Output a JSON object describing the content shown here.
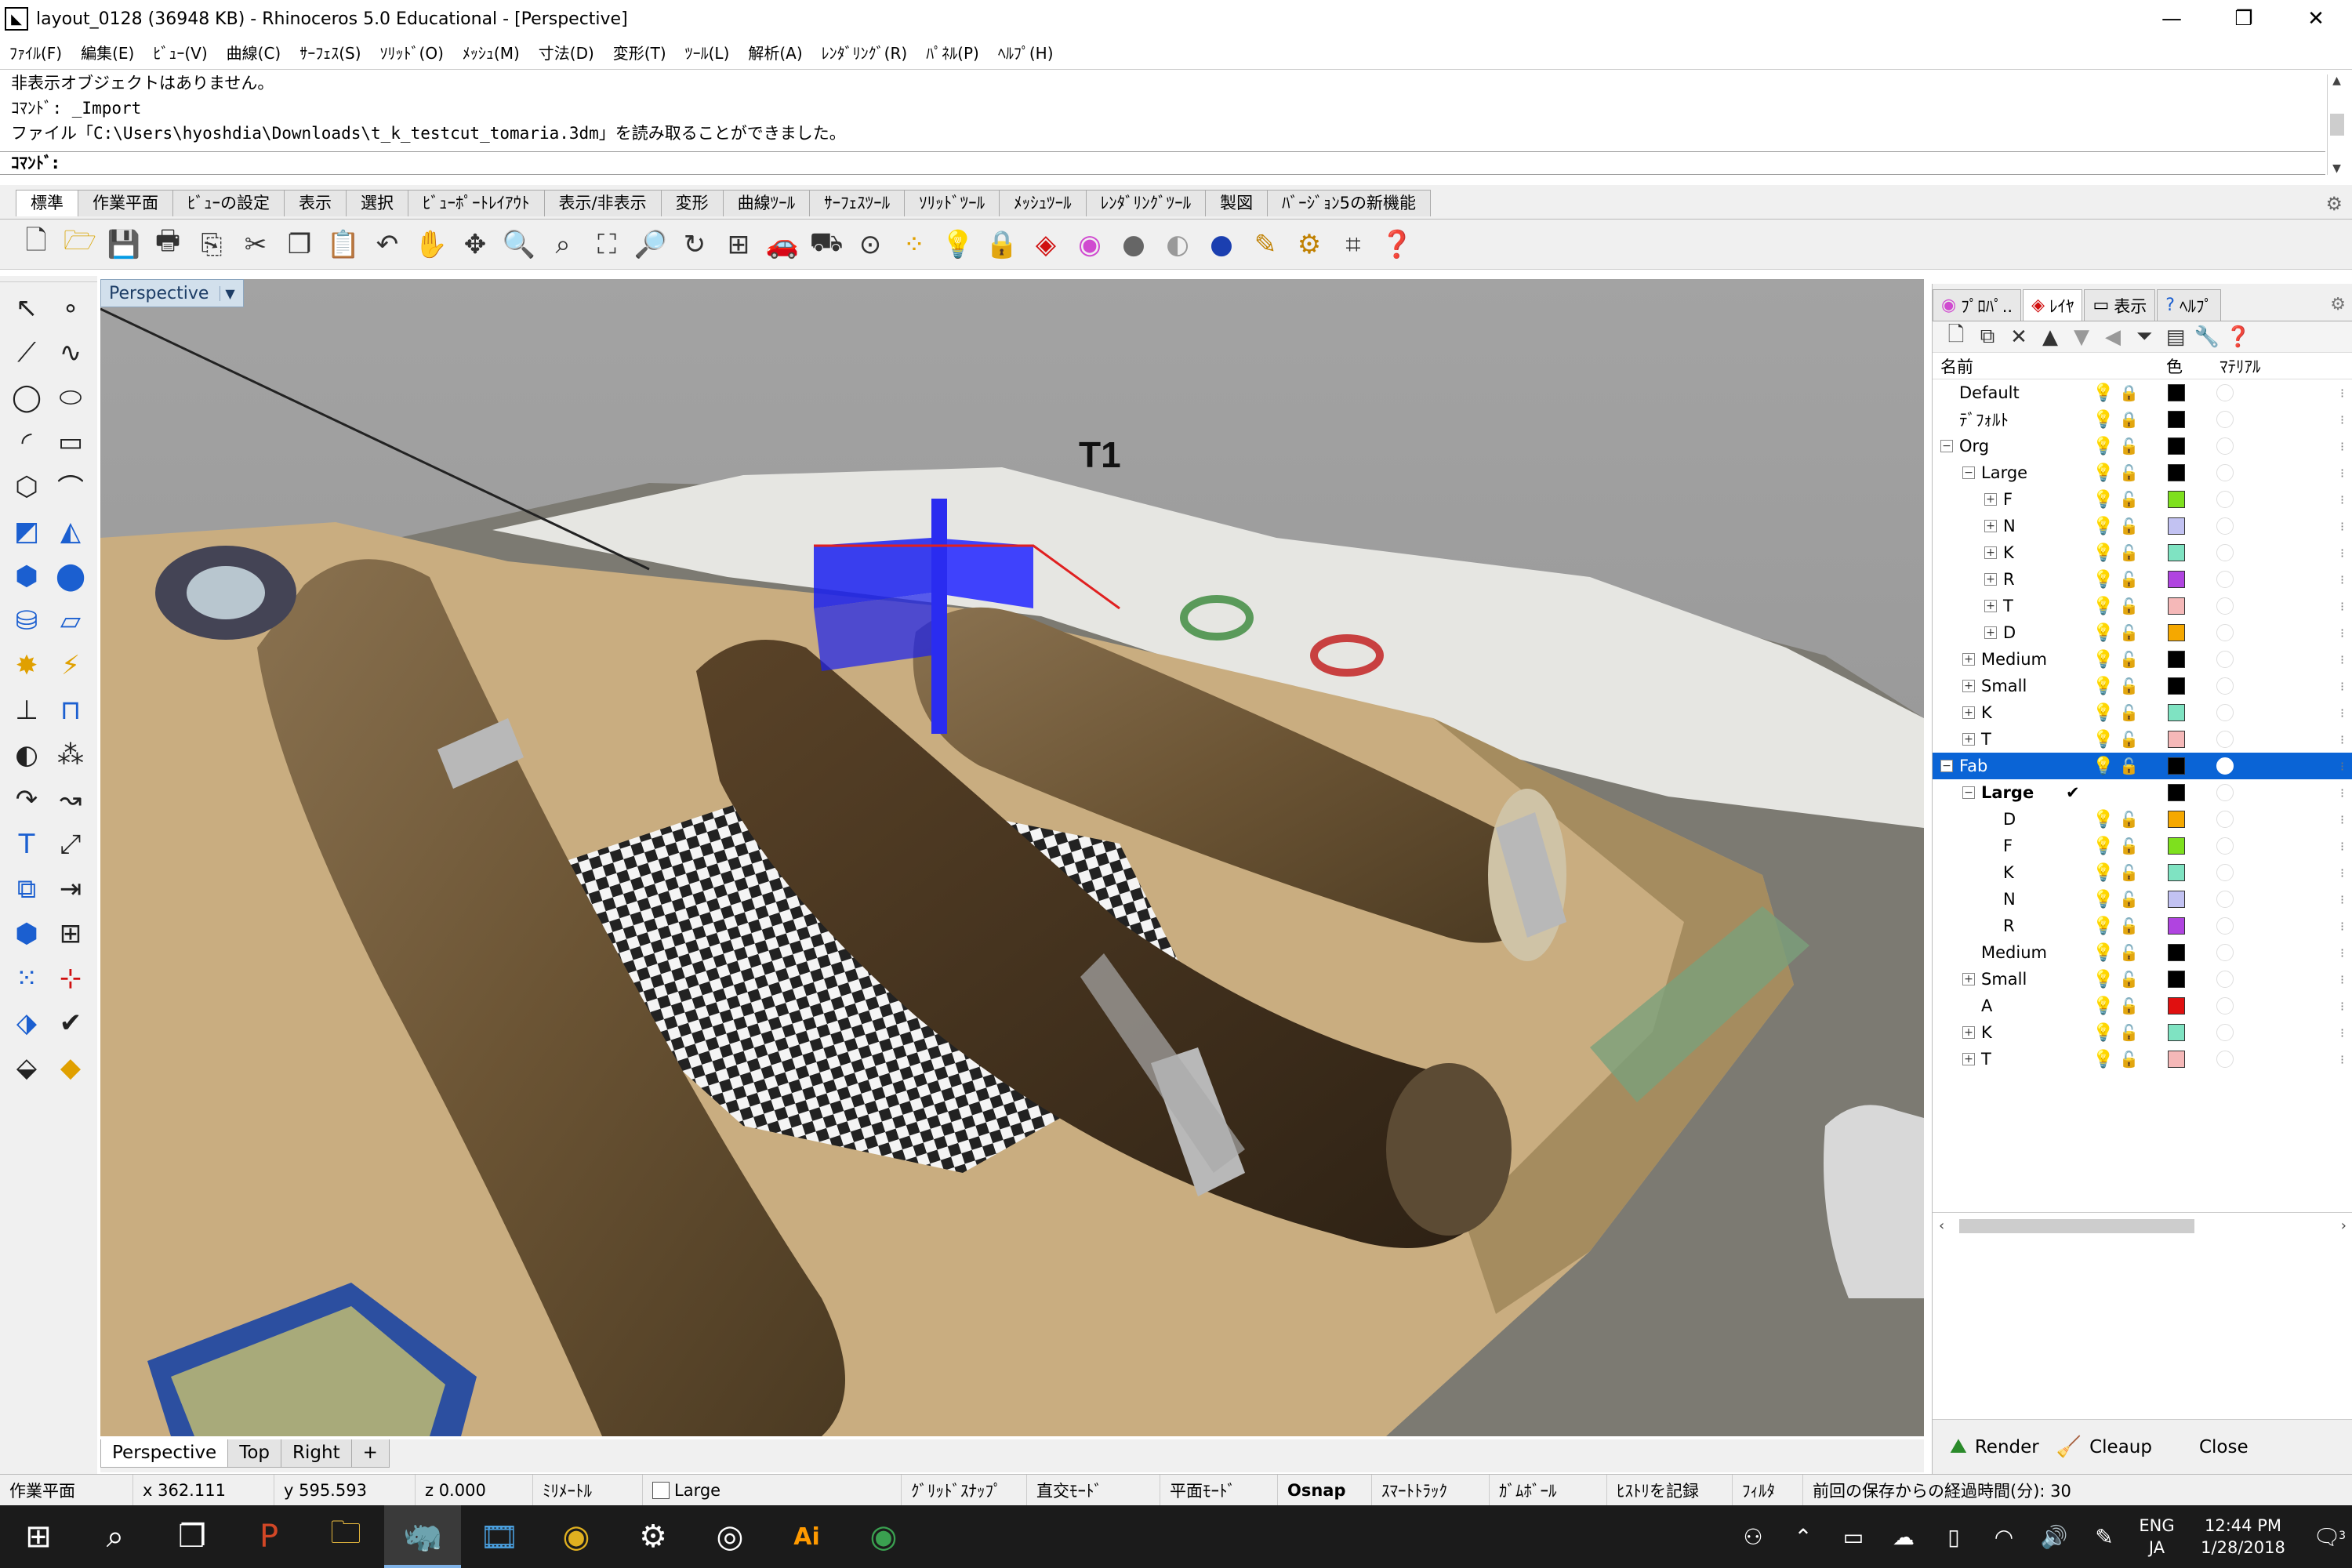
{
  "window": {
    "title": "layout_0128 (36948 KB) - Rhinoceros 5.0 Educational - [Perspective]",
    "app_icon": "rhino-icon",
    "minimize": "—",
    "maximize": "❐",
    "close": "✕"
  },
  "menu": [
    "ﾌｧｲﾙ(F)",
    "編集(E)",
    "ﾋﾞｭｰ(V)",
    "曲線(C)",
    "ｻｰﾌｪｽ(S)",
    "ｿﾘｯﾄﾞ(O)",
    "ﾒｯｼｭ(M)",
    "寸法(D)",
    "変形(T)",
    "ﾂｰﾙ(L)",
    "解析(A)",
    "ﾚﾝﾀﾞﾘﾝｸﾞ(R)",
    "ﾊﾟﾈﾙ(P)",
    "ﾍﾙﾌﾟ(H)"
  ],
  "command": {
    "history": [
      "非表示オブジェクトはありません。",
      "ｺﾏﾝﾄﾞ: _Import",
      "ファイル「C:\\Users\\hyoshdia\\Downloads\\t_k_testcut_tomaria.3dm」を読み取ることができました。"
    ],
    "prompt": "ｺﾏﾝﾄﾞ:"
  },
  "toolbar_tabs": [
    "標準",
    "作業平面",
    "ﾋﾞｭｰの設定",
    "表示",
    "選択",
    "ﾋﾞｭｰﾎﾟｰﾄﾚｲｱｳﾄ",
    "表示/非表示",
    "変形",
    "曲線ﾂｰﾙ",
    "ｻｰﾌｪｽﾂｰﾙ",
    "ｿﾘｯﾄﾞﾂｰﾙ",
    "ﾒｯｼｭﾂｰﾙ",
    "ﾚﾝﾀﾞﾘﾝｸﾞﾂｰﾙ",
    "製図",
    "ﾊﾞｰｼﾞｮﾝ5の新機能"
  ],
  "toolbar_icons": [
    "new-file-icon",
    "open-folder-icon",
    "save-icon",
    "print-icon",
    "import-icon",
    "cut-icon",
    "copy-icon",
    "paste-icon",
    "undo-icon",
    "pan-hand-icon",
    "rotate-view-icon",
    "zoom-icon",
    "zoom-window-icon",
    "zoom-extents-icon",
    "zoom-selected-icon",
    "rotate-camera-icon",
    "four-viewports-icon",
    "car-icon",
    "render-preview-icon",
    "cplane-icon",
    "points-icon",
    "lightbulb-icon",
    "lock-icon",
    "layer-icon",
    "color-wheel-icon",
    "sphere-shaded-icon",
    "sphere-rendered-icon",
    "sphere-blue-icon",
    "pen-icon",
    "gear-icon",
    "dimension-icon",
    "help-icon"
  ],
  "viewport": {
    "name": "Perspective",
    "annotation": "T1",
    "tabs": [
      "Perspective",
      "Top",
      "Right"
    ],
    "add_tab": "+"
  },
  "right_panel": {
    "tabs": [
      {
        "label": "ﾌﾟﾛﾊﾟ..",
        "icon": "properties-icon"
      },
      {
        "label": "ﾚｲﾔ",
        "icon": "layers-icon"
      },
      {
        "label": "表示",
        "icon": "display-icon"
      },
      {
        "label": "ﾍﾙﾌﾟ",
        "icon": "help-tab-icon"
      }
    ],
    "columns": {
      "name": "名前",
      "color": "色",
      "material": "ﾏﾃﾘｱﾙ"
    },
    "layers": [
      {
        "name": "Default",
        "level": 0,
        "expander": "",
        "bulb": "#f2d100",
        "lock": "locked",
        "color": "#000000"
      },
      {
        "name": "ﾃﾞﾌｫﾙﾄ",
        "level": 0,
        "expander": "",
        "bulb": "#f2d100",
        "lock": "locked",
        "color": "#000000"
      },
      {
        "name": "Org",
        "level": 0,
        "expander": "−",
        "bulb": "#f2d100",
        "lock": "open",
        "color": "#000000"
      },
      {
        "name": "Large",
        "level": 1,
        "expander": "−",
        "bulb": "#f2d100",
        "lock": "open",
        "color": "#000000"
      },
      {
        "name": "F",
        "level": 2,
        "expander": "+",
        "bulb": "#2a8bd6",
        "lock": "open",
        "color": "#7ee01e"
      },
      {
        "name": "N",
        "level": 2,
        "expander": "+",
        "bulb": "#2a8bd6",
        "lock": "open",
        "color": "#c2c2f2"
      },
      {
        "name": "K",
        "level": 2,
        "expander": "+",
        "bulb": "#2a8bd6",
        "lock": "open",
        "color": "#7fe3c2"
      },
      {
        "name": "R",
        "level": 2,
        "expander": "+",
        "bulb": "#2a8bd6",
        "lock": "open",
        "color": "#b044e0"
      },
      {
        "name": "T",
        "level": 2,
        "expander": "+",
        "bulb": "#2a8bd6",
        "lock": "open",
        "color": "#f5b8b8"
      },
      {
        "name": "D",
        "level": 2,
        "expander": "+",
        "bulb": "#2a8bd6",
        "lock": "open",
        "color": "#f5a800"
      },
      {
        "name": "Medium",
        "level": 1,
        "expander": "+",
        "bulb": "#2a8bd6",
        "lock": "open",
        "color": "#000000"
      },
      {
        "name": "Small",
        "level": 1,
        "expander": "+",
        "bulb": "#2a8bd6",
        "lock": "open",
        "color": "#000000"
      },
      {
        "name": "K",
        "level": 1,
        "expander": "+",
        "bulb": "#2a8bd6",
        "lock": "open",
        "color": "#7fe3c2"
      },
      {
        "name": "T",
        "level": 1,
        "expander": "+",
        "bulb": "#2a8bd6",
        "lock": "open",
        "color": "#f5b8b8"
      },
      {
        "name": "Fab",
        "level": 0,
        "expander": "−",
        "bulb": "#f2d100",
        "lock": "open",
        "color": "#000000",
        "selected": true
      },
      {
        "name": "Large",
        "level": 1,
        "expander": "−",
        "bulb": "",
        "lock": "",
        "color": "#000000",
        "current": true,
        "check": "✔"
      },
      {
        "name": "D",
        "level": 2,
        "expander": "",
        "bulb": "#2a8bd6",
        "lock": "open",
        "color": "#f5a800"
      },
      {
        "name": "F",
        "level": 2,
        "expander": "",
        "bulb": "#2a8bd6",
        "lock": "open",
        "color": "#7ee01e"
      },
      {
        "name": "K",
        "level": 2,
        "expander": "",
        "bulb": "#2a8bd6",
        "lock": "open",
        "color": "#7fe3c2"
      },
      {
        "name": "N",
        "level": 2,
        "expander": "",
        "bulb": "#2a8bd6",
        "lock": "open",
        "color": "#c2c2f2"
      },
      {
        "name": "R",
        "level": 2,
        "expander": "",
        "bulb": "#2a8bd6",
        "lock": "open",
        "color": "#b044e0"
      },
      {
        "name": "Medium",
        "level": 1,
        "expander": "",
        "bulb": "#2a8bd6",
        "lock": "open",
        "color": "#000000"
      },
      {
        "name": "Small",
        "level": 1,
        "expander": "+",
        "bulb": "#2a8bd6",
        "lock": "open",
        "color": "#000000"
      },
      {
        "name": "A",
        "level": 1,
        "expander": "",
        "bulb": "#f2d100",
        "lock": "open",
        "color": "#e01010"
      },
      {
        "name": "K",
        "level": 1,
        "expander": "+",
        "bulb": "#2a8bd6",
        "lock": "open",
        "color": "#7fe3c2"
      },
      {
        "name": "T",
        "level": 1,
        "expander": "+",
        "bulb": "#f2d100",
        "lock": "open",
        "color": "#f5b8b8"
      }
    ],
    "buttons": {
      "render": "Render",
      "cleanup": "Cleaup",
      "close": "Close"
    }
  },
  "status": {
    "cplane": "作業平面",
    "x": "x 362.111",
    "y": "y 595.593",
    "z": "z 0.000",
    "units": "ﾐﾘﾒｰﾄﾙ",
    "layer": "Large",
    "grid_snap": "ｸﾞﾘｯﾄﾞｽﾅｯﾌﾟ",
    "ortho": "直交ﾓｰﾄﾞ",
    "planar": "平面ﾓｰﾄﾞ",
    "osnap": "Osnap",
    "smarttrack": "ｽﾏｰﾄﾄﾗｯｸ",
    "gumball": "ｶﾞﾑﾎﾞｰﾙ",
    "history": "ﾋｽﾄﾘを記録",
    "filter": "ﾌｨﾙﾀ",
    "autosave": "前回の保存からの経過時間(分): 30"
  },
  "taskbar": {
    "apps": [
      "windows-start-icon",
      "search-icon",
      "task-view-icon",
      "powerpoint-icon",
      "file-explorer-icon",
      "rhino-taskbar-icon",
      "video-icon",
      "chrome-icon",
      "settings-icon",
      "eye-app-icon",
      "illustrator-icon",
      "chrome-profile-icon"
    ],
    "illustrator_label": "Ai",
    "lang": [
      "ENG",
      "JA"
    ],
    "time": "12:44 PM",
    "date": "1/28/2018",
    "notifications": "3"
  }
}
